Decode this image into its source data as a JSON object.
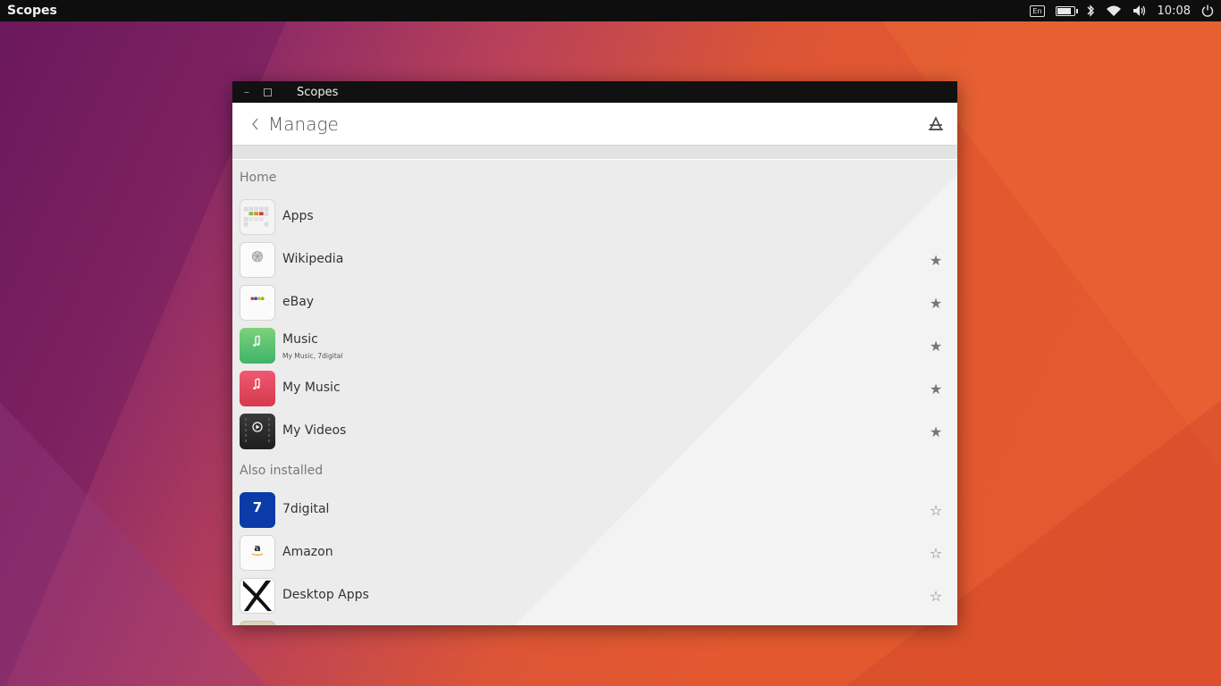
{
  "panel": {
    "app_name": "Scopes",
    "keyboard_layout": "En",
    "time": "10:08",
    "icons": [
      "keyboard-icon",
      "battery-icon",
      "bluetooth-icon",
      "network-icon",
      "volume-icon",
      "clock",
      "power-icon"
    ]
  },
  "window": {
    "title": "Scopes",
    "buttons": [
      "minimize",
      "maximize"
    ]
  },
  "header": {
    "title": "Manage",
    "back_icon": "chevron-left-icon",
    "store_icon": "store-icon"
  },
  "sections": [
    {
      "label": "Home",
      "items": [
        {
          "name": "Apps",
          "subtitle": "",
          "icon": "apps-icon",
          "favorite": null
        },
        {
          "name": "Wikipedia",
          "subtitle": "",
          "icon": "wikipedia-icon",
          "favorite": true
        },
        {
          "name": "eBay",
          "subtitle": "",
          "icon": "ebay-icon",
          "favorite": true
        },
        {
          "name": "Music",
          "subtitle": "My Music, 7digital",
          "icon": "music-icon",
          "favorite": true
        },
        {
          "name": "My Music",
          "subtitle": "",
          "icon": "my-music-icon",
          "favorite": true
        },
        {
          "name": "My Videos",
          "subtitle": "",
          "icon": "my-videos-icon",
          "favorite": true
        }
      ]
    },
    {
      "label": "Also installed",
      "items": [
        {
          "name": "7digital",
          "subtitle": "",
          "icon": "7digital-icon",
          "favorite": false
        },
        {
          "name": "Amazon",
          "subtitle": "",
          "icon": "amazon-icon",
          "favorite": false
        },
        {
          "name": "Desktop Apps",
          "subtitle": "",
          "icon": "desktop-apps-icon",
          "favorite": false
        }
      ]
    }
  ],
  "colors": {
    "panel_bg": "#0e0e0e",
    "header_bg": "#ffffff",
    "list_bg": "#ececec",
    "star": "#777777"
  },
  "glyphs": {
    "star_filled": "★",
    "star_empty": "☆",
    "seven": "7",
    "amazon_a": "a"
  }
}
